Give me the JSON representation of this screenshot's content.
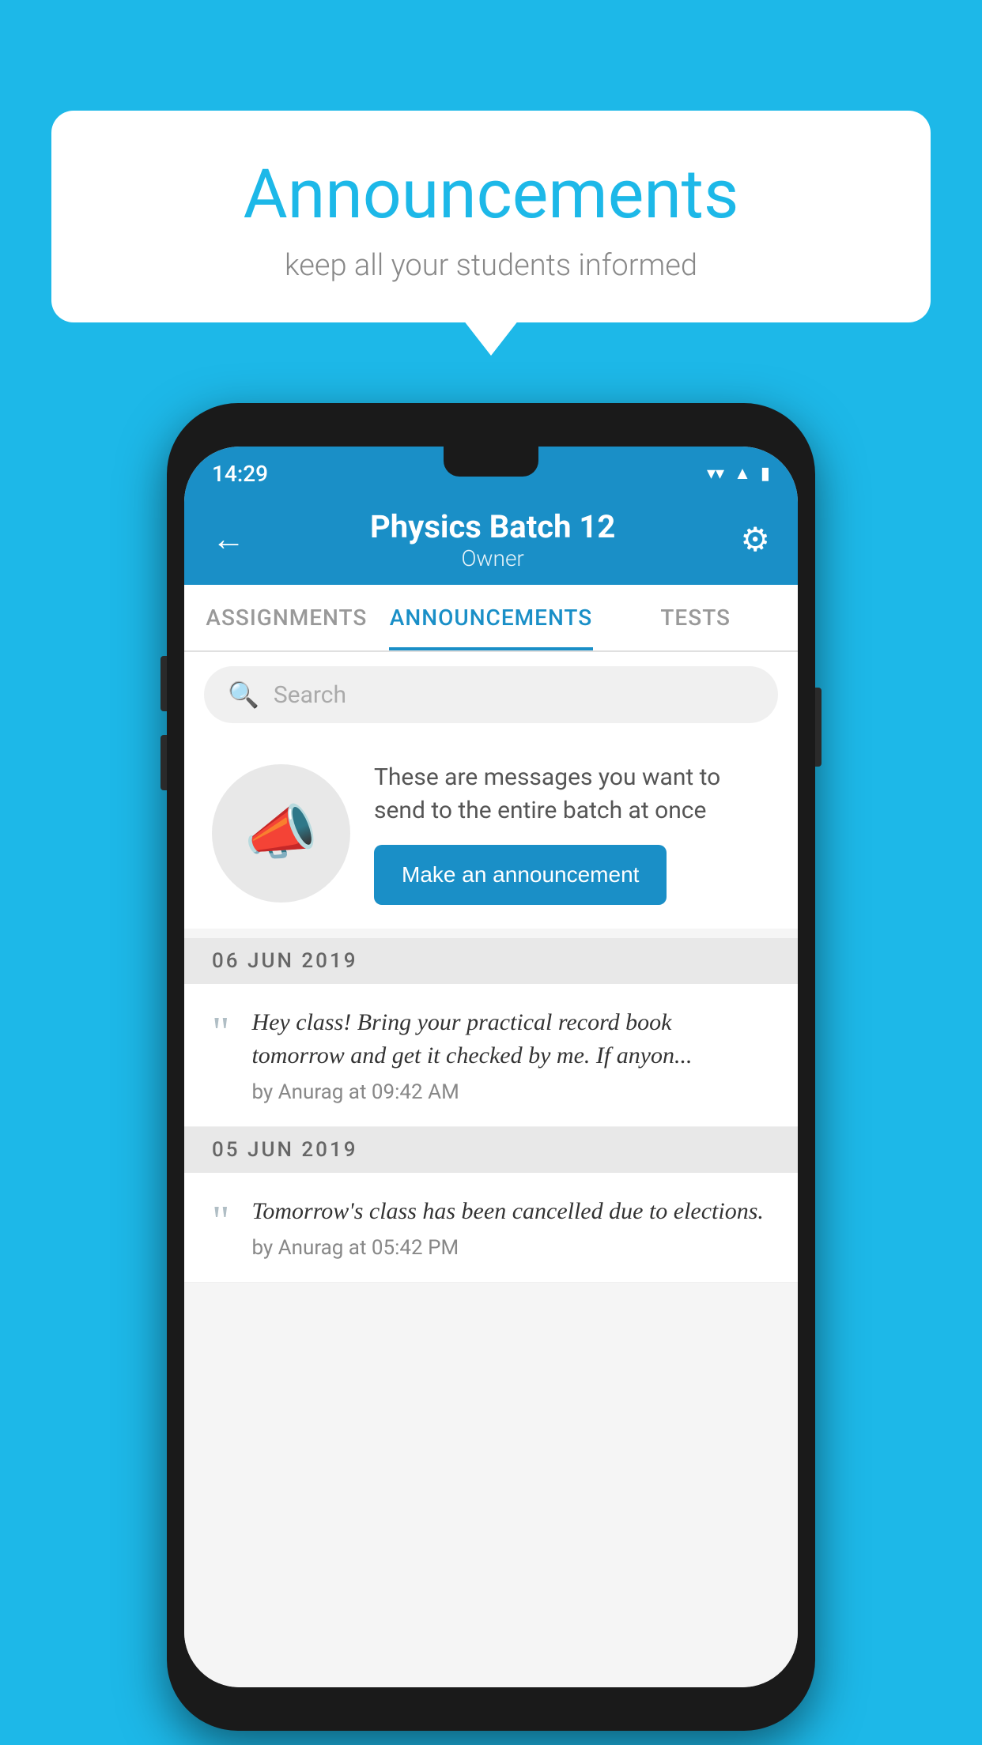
{
  "background_color": "#1db8e8",
  "speech_bubble": {
    "title": "Announcements",
    "subtitle": "keep all your students informed"
  },
  "phone": {
    "status_bar": {
      "time": "14:29",
      "wifi_icon": "wifi",
      "signal_icon": "signal",
      "battery_icon": "battery"
    },
    "app_bar": {
      "back_label": "←",
      "title": "Physics Batch 12",
      "subtitle": "Owner",
      "settings_icon": "⚙"
    },
    "tabs": [
      {
        "label": "ASSIGNMENTS",
        "active": false
      },
      {
        "label": "ANNOUNCEMENTS",
        "active": true
      },
      {
        "label": "TESTS",
        "active": false
      }
    ],
    "search": {
      "placeholder": "Search"
    },
    "promo": {
      "description": "These are messages you want to send to the entire batch at once",
      "button_label": "Make an announcement"
    },
    "announcements": [
      {
        "date": "06  JUN  2019",
        "text": "Hey class! Bring your practical record book tomorrow and get it checked by me. If anyon...",
        "meta": "by Anurag at 09:42 AM"
      },
      {
        "date": "05  JUN  2019",
        "text": "Tomorrow's class has been cancelled due to elections.",
        "meta": "by Anurag at 05:42 PM"
      }
    ]
  }
}
